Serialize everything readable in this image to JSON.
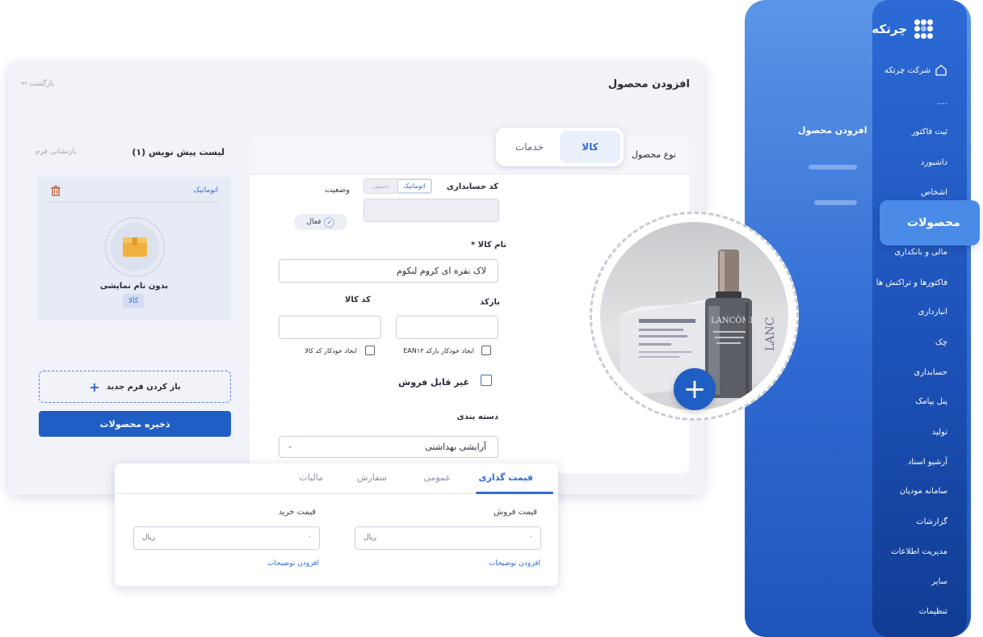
{
  "nav": {
    "brand": "چرتکه",
    "company": "شرکت چرتکه",
    "ellipsis": "....",
    "items": [
      "ثبت فاکتور",
      "داشبورد",
      "اشخاص",
      "محصولات",
      "مالی و بانکداری",
      "فاکتورها و تراکنش ها",
      "انبارداری",
      "چک",
      "حسابداری",
      "پنل پیامک",
      "تولید",
      "آرشیو اسناد",
      "سامانه مودیان",
      "گزارشات",
      "مدیریت اطلاعات",
      "سایر",
      "تنظیمات"
    ],
    "active_item": "محصولات",
    "submenu_title": "افزودن محصول"
  },
  "page": {
    "title": "افزودن محصول",
    "back": "بازگشت"
  },
  "drafts": {
    "title": "لیست پیش نویس (۱)",
    "reset": "بازنشانی فرم",
    "item": {
      "mode": "اتوماتیک",
      "name": "بدون نام نمایشی",
      "badge": "کالا"
    },
    "open_form": "باز کردن فرم جدید",
    "save": "ذخیره محصولات"
  },
  "form": {
    "type_label": "نوع محصول",
    "type_options": [
      "کالا",
      "خدمات"
    ],
    "type_selected": "کالا",
    "accounting_code_label": "کد حسابداری",
    "code_mode_auto": "اتوماتیک",
    "code_mode_manual": "دستی",
    "status_label": "وضعیت",
    "status_value": "فعال",
    "name_label": "نام کالا *",
    "name_value": "لاک نقره ای کروم لنکوم",
    "barcode_label": "بارکد",
    "item_code_label": "کد کالا",
    "auto_barcode": "ایجاد خودکار بارکد EAN۱۳",
    "auto_item_code": "ایجاد خودکار کد کالا",
    "not_for_sale": "غیر قابل فروش",
    "category_label": "دسته بندی",
    "category_value": "آرایشی بهداشتی"
  },
  "pricing": {
    "tabs": [
      "قیمت گذاری",
      "عمومی",
      "سفارش",
      "مالیات"
    ],
    "active_tab": "قیمت گذاری",
    "sell_label": "قیمت فروش",
    "buy_label": "قیمت خرید",
    "currency": "ریال",
    "sell_value": "۰",
    "buy_value": "۰",
    "add_desc": "افزودن توضیحات"
  },
  "image": {
    "brand_text": "LANCÔME",
    "add_icon": "plus-icon"
  }
}
